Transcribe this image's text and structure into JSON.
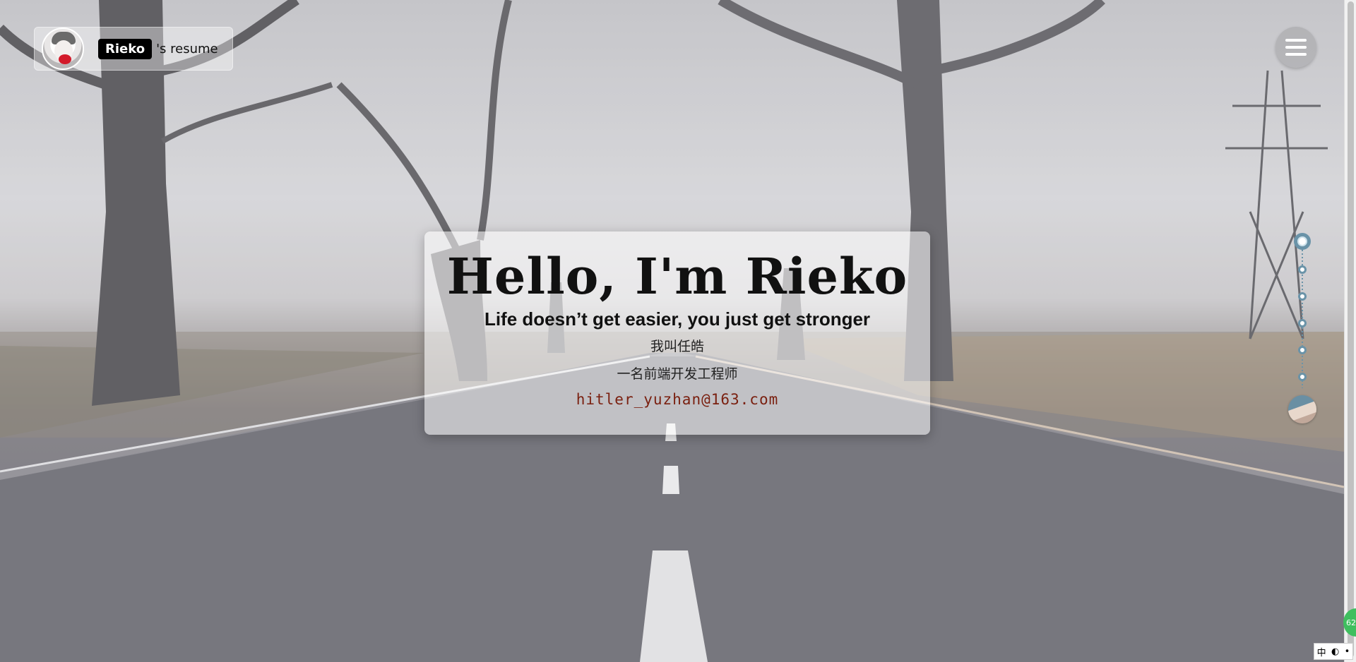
{
  "brand": {
    "name": "Rieko",
    "suffix": "'s resume"
  },
  "hero": {
    "title": "Hello, I'm Rieko",
    "tagline": "Life doesn’t get easier, you just get stronger",
    "cn_name": "我叫任皓",
    "cn_title": "一名前端开发工程师",
    "email": "hitler_yuzhan@163.com"
  },
  "nav": {
    "dot_count": 6,
    "active_index": 0
  },
  "tray": {
    "badge": "62",
    "ime_lang": "中",
    "ime_mode": "◐",
    "ime_dot": "•"
  },
  "colors": {
    "accent": "#6a93a8",
    "email": "#7a2010",
    "badge": "#3fbf5f"
  }
}
